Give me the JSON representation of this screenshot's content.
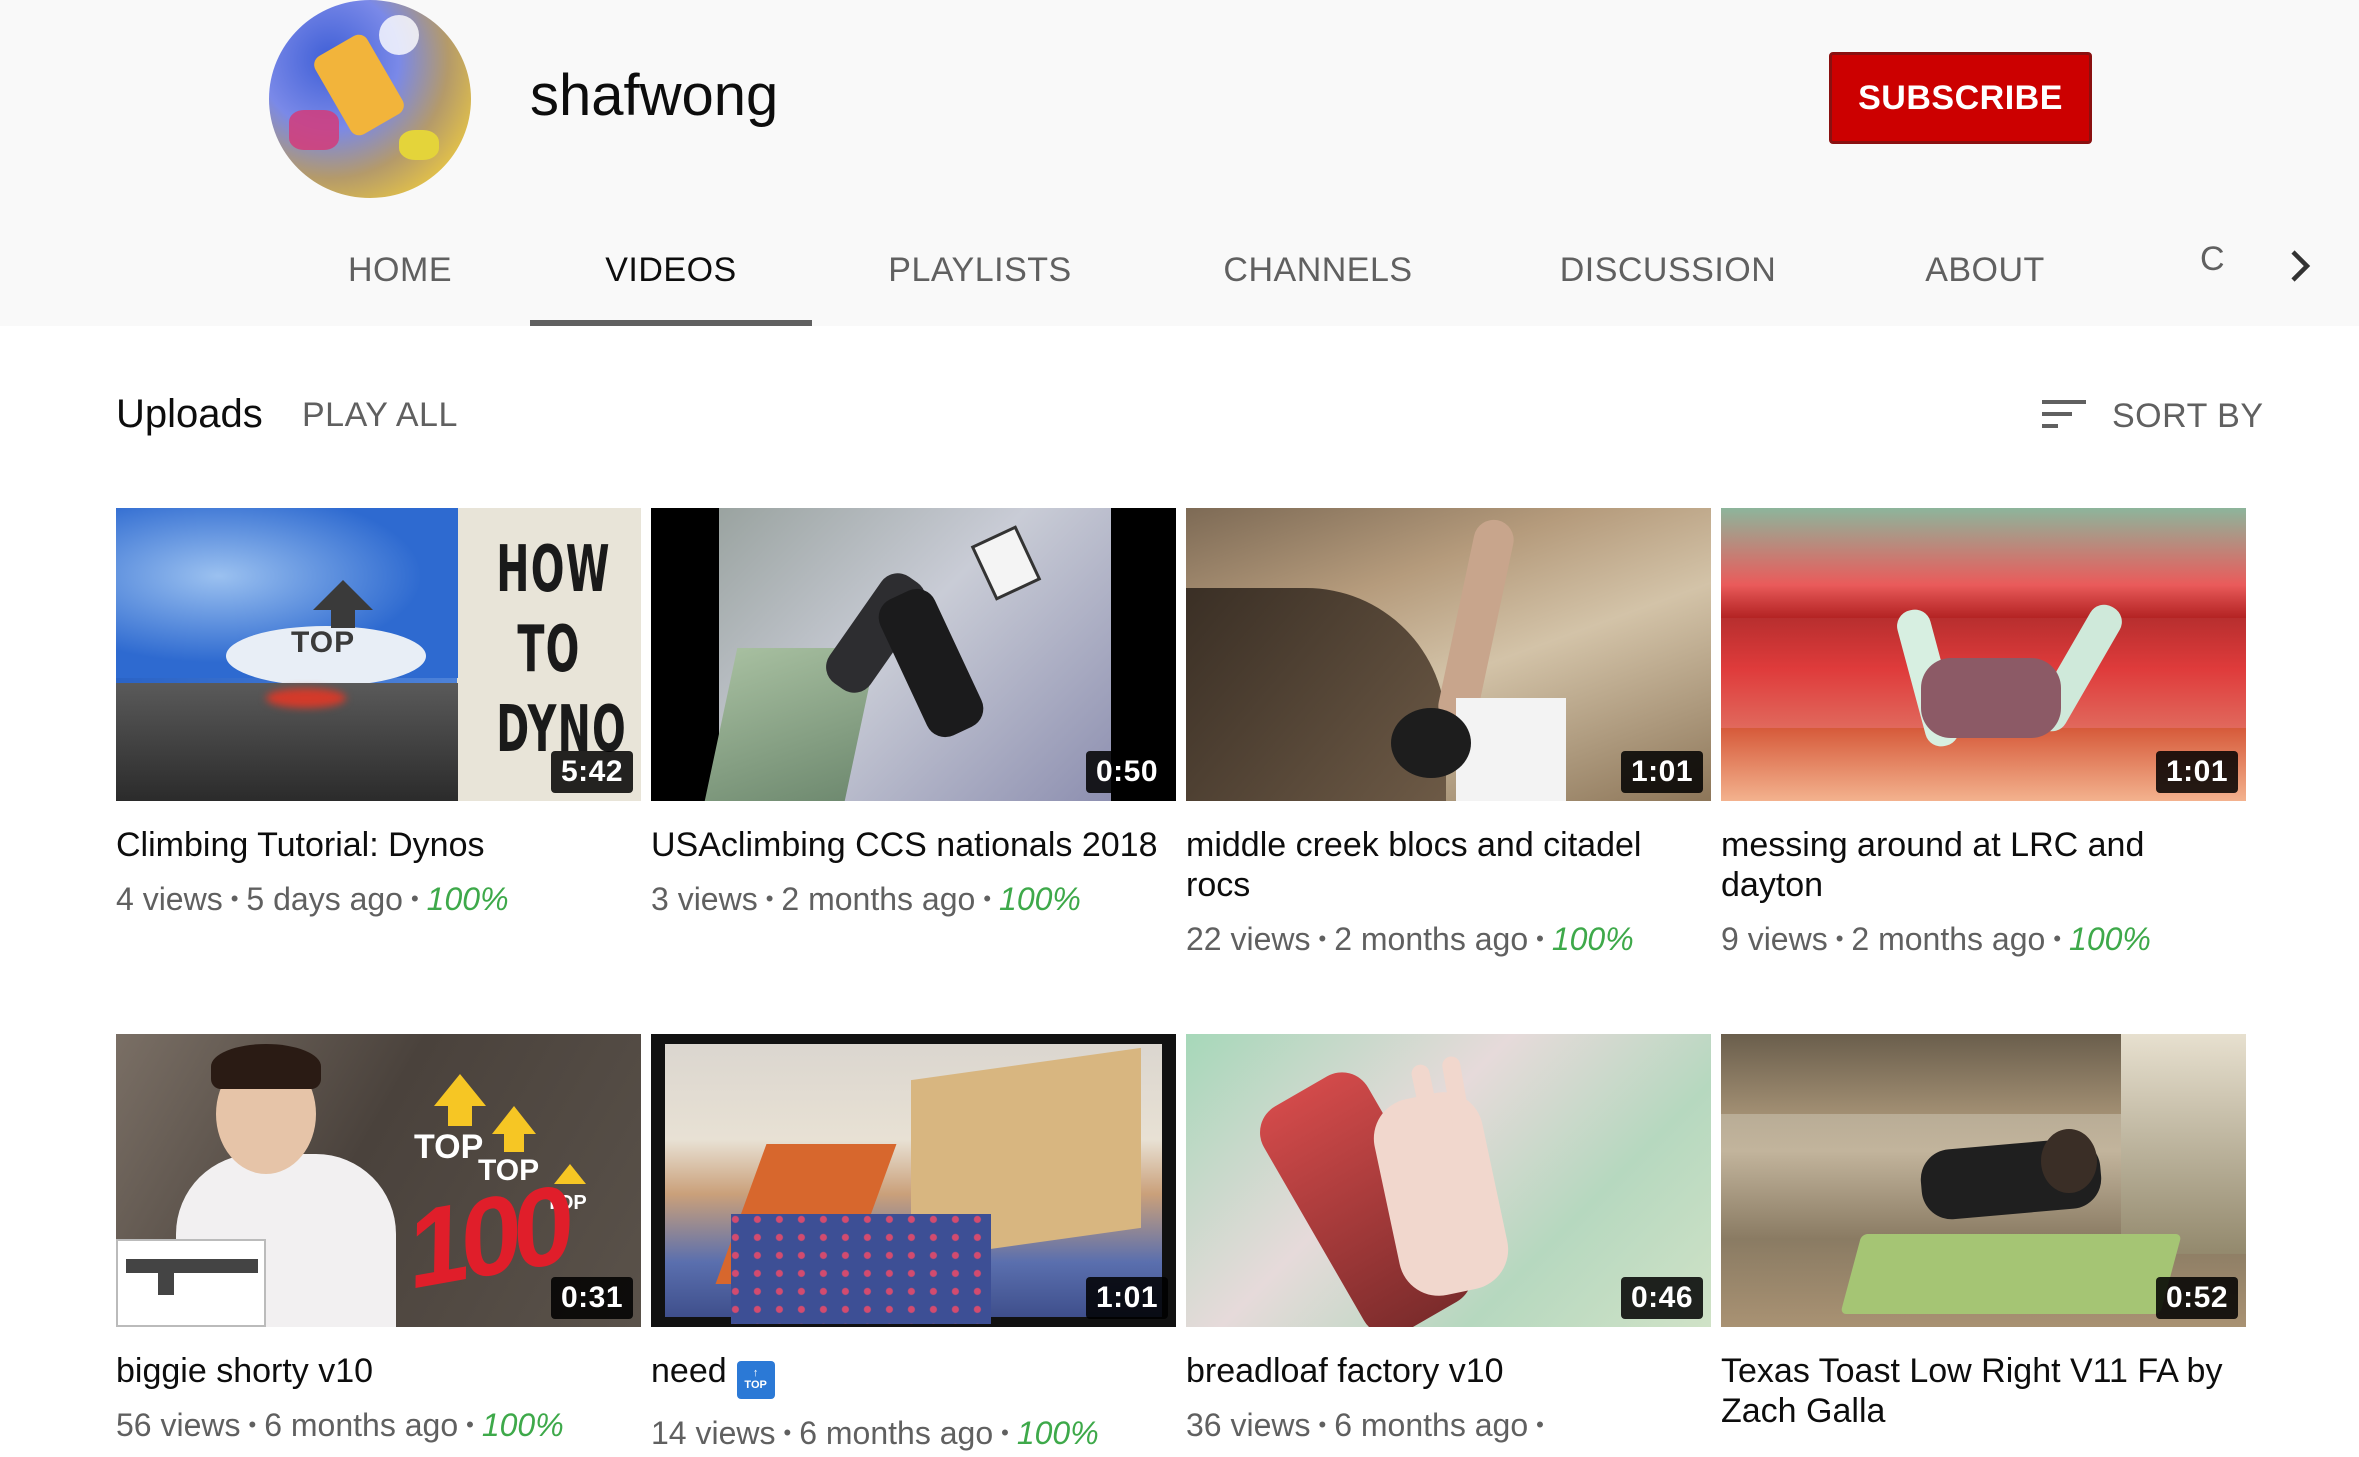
{
  "channel": {
    "name": "shafwong",
    "subscribe_label": "SUBSCRIBE"
  },
  "tabs": [
    {
      "label": "HOME",
      "active": false
    },
    {
      "label": "VIDEOS",
      "active": true
    },
    {
      "label": "PLAYLISTS",
      "active": false
    },
    {
      "label": "CHANNELS",
      "active": false
    },
    {
      "label": "DISCUSSION",
      "active": false
    },
    {
      "label": "ABOUT",
      "active": false
    }
  ],
  "tab_partial": "C",
  "section": {
    "title": "Uploads",
    "play_all_label": "PLAY ALL",
    "sort_label": "SORT BY"
  },
  "videos": [
    {
      "title": "Climbing Tutorial: Dynos",
      "views": "4 views",
      "age": "5 days ago",
      "rating": "100%",
      "duration": "5:42",
      "thumb_text": "HOW TO DYNO",
      "thumb_top": "TOP"
    },
    {
      "title": "USAclimbing CCS nationals 2018",
      "views": "3 views",
      "age": "2 months ago",
      "rating": "100%",
      "duration": "0:50"
    },
    {
      "title": "middle creek blocs and citadel rocs",
      "views": "22 views",
      "age": "2 months ago",
      "rating": "100%",
      "duration": "1:01"
    },
    {
      "title": "messing around at LRC and dayton",
      "views": "9 views",
      "age": "2 months ago",
      "rating": "100%",
      "duration": "1:01"
    },
    {
      "title": "biggie shorty v10",
      "views": "56 views",
      "age": "6 months ago",
      "rating": "100%",
      "duration": "0:31",
      "thumb_top_1": "TOP",
      "thumb_top_2": "TOP",
      "thumb_top_3": "TOP",
      "thumb_hundred": "100"
    },
    {
      "title": "need",
      "views": "14 views",
      "age": "6 months ago",
      "rating": "100%",
      "duration": "1:01",
      "badge": "TOP"
    },
    {
      "title": "breadloaf factory v10",
      "views": "36 views",
      "age": "6 months ago",
      "rating": "",
      "duration": "0:46"
    },
    {
      "title": "Texas Toast Low Right V11 FA by Zach Galla",
      "views": "",
      "age": "",
      "rating": "",
      "duration": "0:52"
    }
  ],
  "colors": {
    "subscribe": "#cc0000",
    "rating": "#3ea94a",
    "secondary_text": "#606060"
  },
  "icons": {
    "sort": "sort-icon",
    "tabs_next": "chevron-right-icon"
  }
}
